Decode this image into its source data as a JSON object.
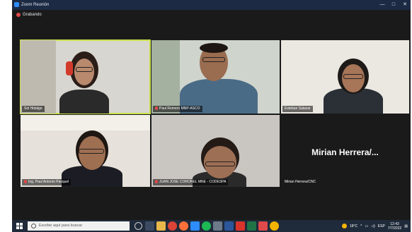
{
  "window": {
    "title": "Zoom Reunión",
    "min": "—",
    "max": "□",
    "close": "✕"
  },
  "recording": {
    "label": "Grabando"
  },
  "participants": [
    {
      "name": "Sol Hidalgo",
      "active": true,
      "muted": false
    },
    {
      "name": "Paul Romero MNP-ASCO",
      "active": false,
      "muted": true
    },
    {
      "name": "Esteban Salazar",
      "active": false,
      "muted": false
    },
    {
      "name": "Ing. Paul Antonio Pasquel",
      "active": false,
      "muted": true
    },
    {
      "name": "JUAN JOSE CORONEL MNE - CODESPA",
      "active": false,
      "muted": true
    },
    {
      "name": "Mirian Herrera/CNC",
      "display_name": "Mirian Herrera/...",
      "active": false,
      "muted": false
    }
  ],
  "taskbar": {
    "search_placeholder": "Escribe aquí para buscar",
    "temperature": "18°C",
    "language": "ESP",
    "time": "12:43",
    "date": "7/7/2022"
  },
  "colors": {
    "active_speaker": "#c9e34a",
    "titlebar": "#1c2a44",
    "background": "#1a1a1a"
  }
}
